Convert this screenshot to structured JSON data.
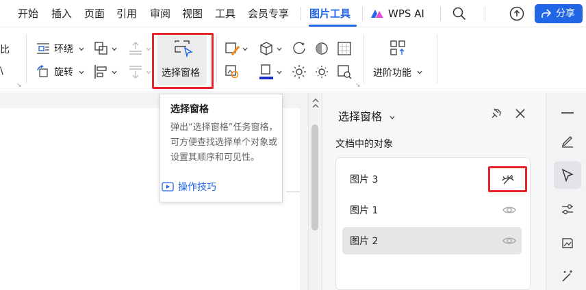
{
  "menubar": {
    "tabs": [
      {
        "label": "开始"
      },
      {
        "label": "插入"
      },
      {
        "label": "页面"
      },
      {
        "label": "引用"
      },
      {
        "label": "审阅"
      },
      {
        "label": "视图"
      },
      {
        "label": "工具"
      },
      {
        "label": "会员专享"
      },
      {
        "label": "图片工具"
      }
    ],
    "wps_ai_label": "WPS AI",
    "share_label": "分享"
  },
  "ribbon": {
    "edge_label_1": "比",
    "edge_label_2": "\\",
    "wrap_label": "环绕",
    "rotate_label": "旋转",
    "selection_pane_label": "选择窗格",
    "advanced_label": "进阶功能"
  },
  "tooltip": {
    "title": "选择窗格",
    "description": "弹出“选择窗格”任务窗格，可方便查找选择单个对象或设置其顺序和可见性。",
    "link": "操作技巧"
  },
  "pane": {
    "title": "选择窗格",
    "subtitle": "文档中的对象",
    "objects": [
      {
        "name": "图片 3",
        "visible": false
      },
      {
        "name": "图片 1",
        "visible": true
      },
      {
        "name": "图片 2",
        "visible": true
      }
    ]
  },
  "colors": {
    "accent": "#2166e6",
    "highlight_red": "#e5252a"
  },
  "icons": [
    "search-icon",
    "cloud-upload-icon",
    "share-icon",
    "pin-icon",
    "close-icon",
    "eye-icon",
    "eye-off-icon",
    "pen-icon",
    "cursor-icon",
    "sliders-icon",
    "image-edit-icon",
    "magic-icon"
  ]
}
